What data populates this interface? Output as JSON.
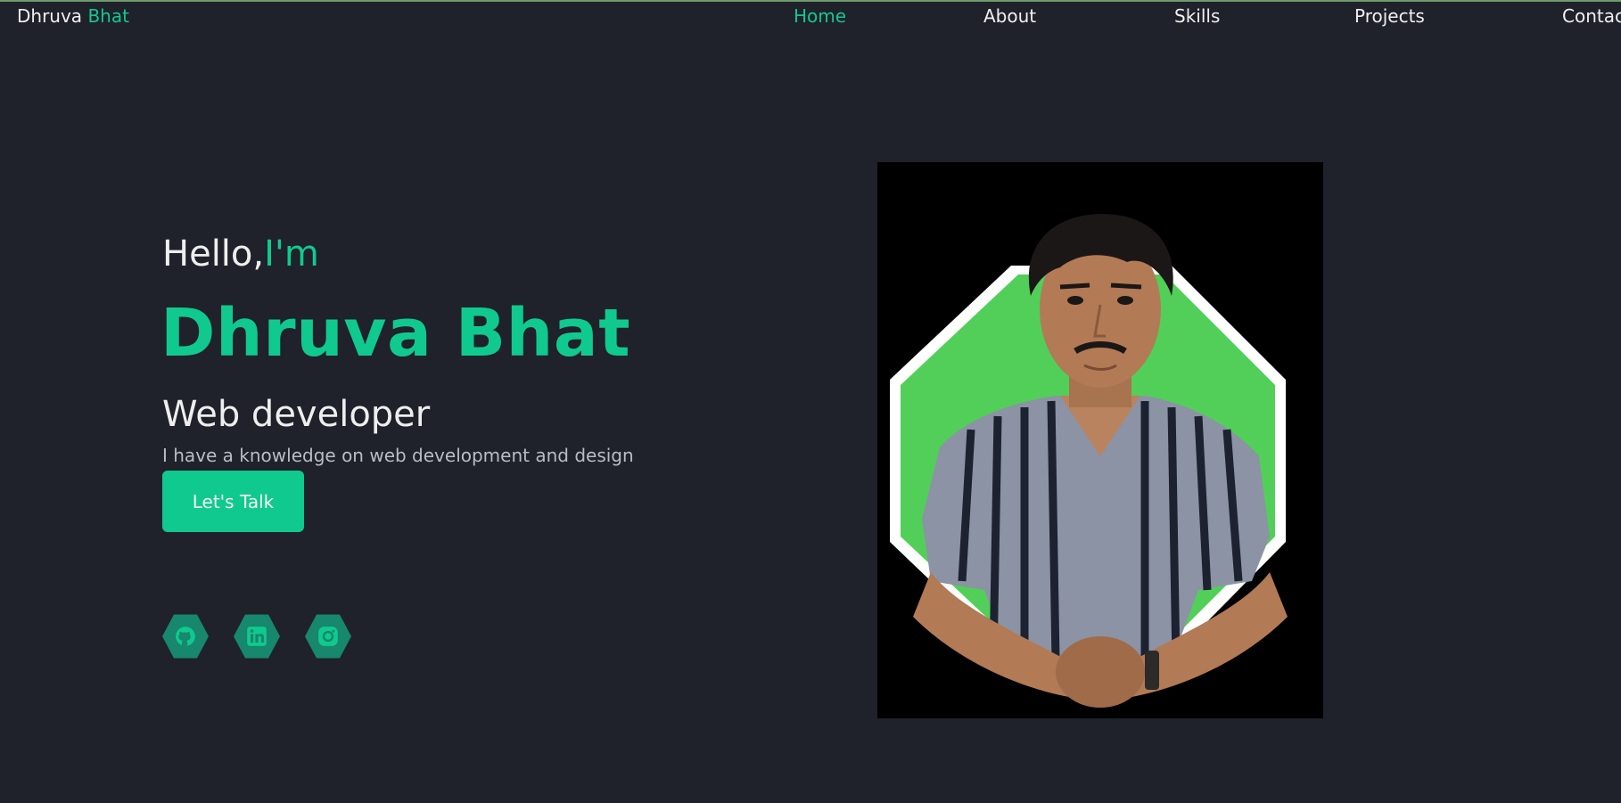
{
  "colors": {
    "background": "#1f212b",
    "accent": "#10c98f",
    "social_bg": "#17876d",
    "photo_green": "#52cf59"
  },
  "nav": {
    "brand_first": "Dhruva",
    "brand_second": "Bhat",
    "links": [
      "Home",
      "About",
      "Skills",
      "Projects",
      "Contac"
    ],
    "active": "Home"
  },
  "hero": {
    "hello": "Hello,",
    "im": "I'm",
    "name": "Dhruva Bhat",
    "role": "Web developer",
    "description": "I have a knowledge on web development and design",
    "cta_label": "Let's Talk"
  },
  "social": [
    {
      "icon": "github-icon"
    },
    {
      "icon": "linkedin-icon"
    },
    {
      "icon": "instagram-icon"
    }
  ],
  "photo": {
    "subject": "portrait-photo"
  }
}
